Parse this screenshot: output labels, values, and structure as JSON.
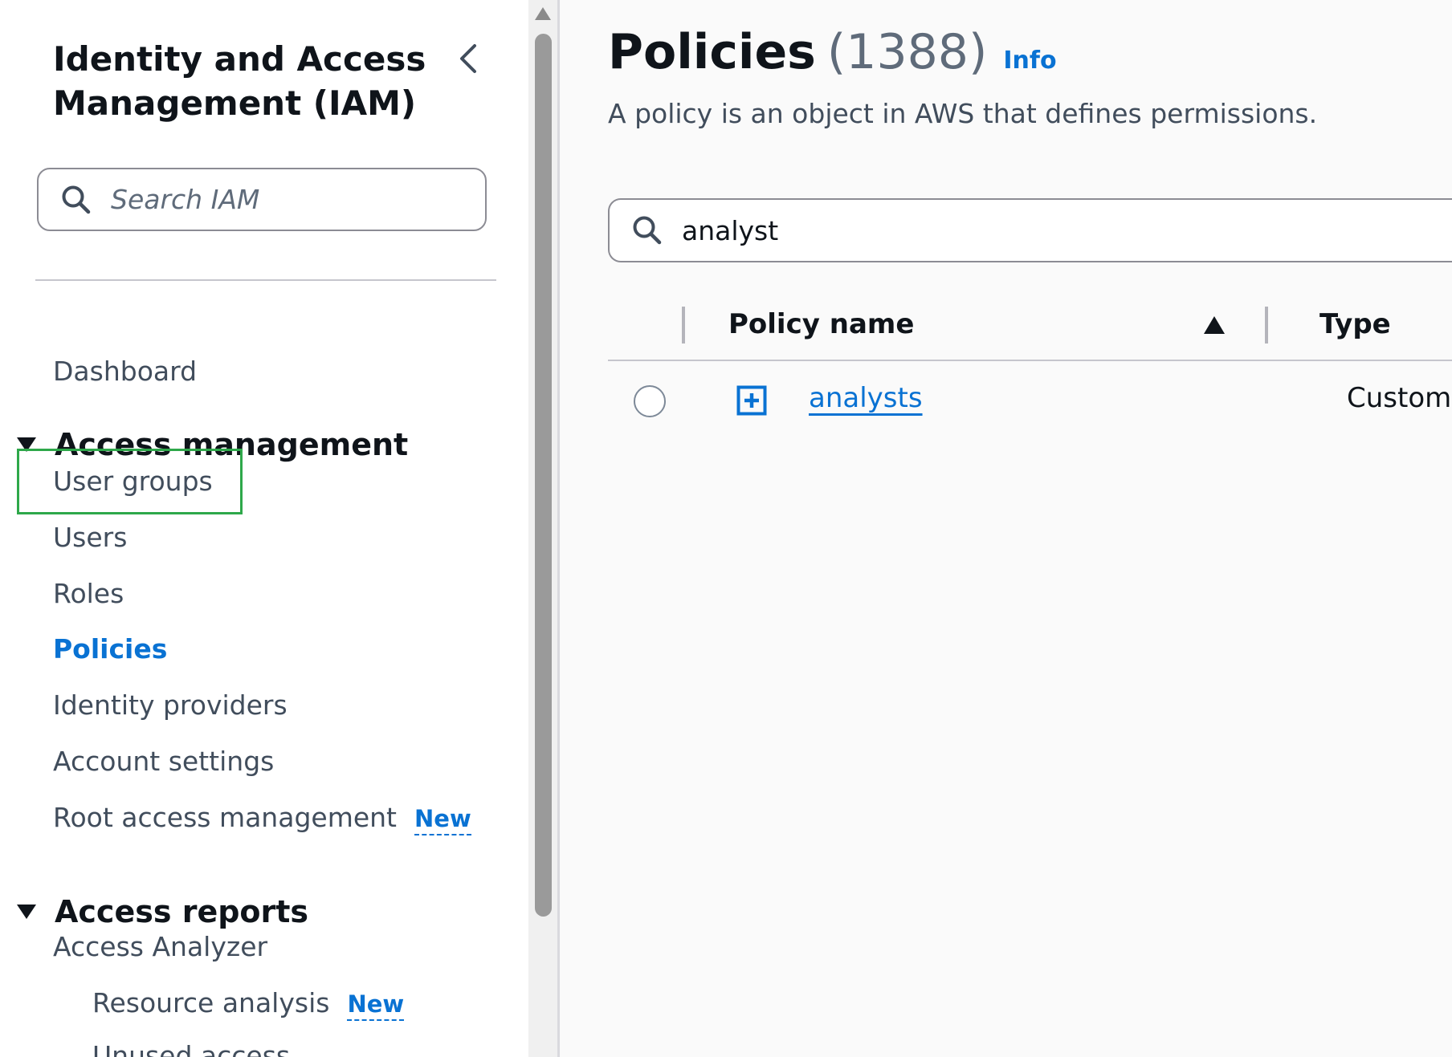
{
  "sidebar": {
    "title": "Identity and Access Management (IAM)",
    "search_placeholder": "Search IAM",
    "dashboard": "Dashboard",
    "sections": [
      {
        "label": "Access management",
        "items": [
          {
            "label": "User groups"
          },
          {
            "label": "Users"
          },
          {
            "label": "Roles"
          },
          {
            "label": "Policies",
            "active": true
          },
          {
            "label": "Identity providers"
          },
          {
            "label": "Account settings"
          },
          {
            "label": "Root access management",
            "badge": "New"
          }
        ]
      },
      {
        "label": "Access reports",
        "items": [
          {
            "label": "Access Analyzer"
          },
          {
            "label": "Resource analysis",
            "badge": "New"
          },
          {
            "label": "Unused access"
          }
        ]
      }
    ]
  },
  "main": {
    "title": "Policies",
    "count": "(1388)",
    "info": "Info",
    "description": "A policy is an object in AWS that defines permissions.",
    "search_value": "analyst",
    "table": {
      "columns": [
        "Policy name",
        "Type"
      ],
      "rows": [
        {
          "name": "analysts",
          "type": "Customer m"
        }
      ]
    }
  },
  "colors": {
    "accent": "#0972d3",
    "highlight": "#2ea84a"
  }
}
